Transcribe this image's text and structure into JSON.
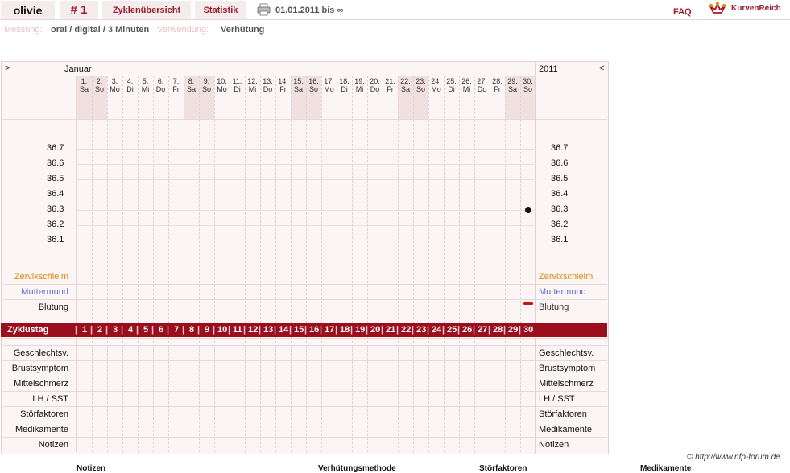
{
  "topbar": {
    "user": "olivie",
    "cycle_num": "# 1",
    "tab_cycles": "Zyklenübersicht",
    "tab_stats": "Statistik",
    "date_range": "01.01.2011 bis ∞",
    "faq": "FAQ",
    "brand": "KurvenReich"
  },
  "meta": {
    "measure_label": "Messung:",
    "measure_value": "oral / digital / 3 Minuten",
    "usage_label": "Verwendung:",
    "usage_value": "Verhütung"
  },
  "chart_header": {
    "prev": ">",
    "month": "Januar",
    "year": "2011",
    "next": "<"
  },
  "days": [
    {
      "d": "1.",
      "w": "Sa",
      "we": true
    },
    {
      "d": "2.",
      "w": "So",
      "we": true
    },
    {
      "d": "3.",
      "w": "Mo"
    },
    {
      "d": "4.",
      "w": "Di"
    },
    {
      "d": "5.",
      "w": "Mi"
    },
    {
      "d": "6.",
      "w": "Do"
    },
    {
      "d": "7.",
      "w": "Fr"
    },
    {
      "d": "8.",
      "w": "Sa",
      "we": true
    },
    {
      "d": "9.",
      "w": "So",
      "we": true
    },
    {
      "d": "10.",
      "w": "Mo"
    },
    {
      "d": "11.",
      "w": "Di"
    },
    {
      "d": "12.",
      "w": "Mi"
    },
    {
      "d": "13.",
      "w": "Do"
    },
    {
      "d": "14.",
      "w": "Fr"
    },
    {
      "d": "15.",
      "w": "Sa",
      "we": true
    },
    {
      "d": "16.",
      "w": "So",
      "we": true
    },
    {
      "d": "17.",
      "w": "Mo"
    },
    {
      "d": "18.",
      "w": "Di"
    },
    {
      "d": "19.",
      "w": "Mi"
    },
    {
      "d": "20.",
      "w": "Do"
    },
    {
      "d": "21.",
      "w": "Fr"
    },
    {
      "d": "22.",
      "w": "Sa",
      "we": true
    },
    {
      "d": "23.",
      "w": "So",
      "we": true
    },
    {
      "d": "24.",
      "w": "Mo"
    },
    {
      "d": "25.",
      "w": "Di"
    },
    {
      "d": "26.",
      "w": "Mi"
    },
    {
      "d": "27.",
      "w": "Do"
    },
    {
      "d": "28.",
      "w": "Fr"
    },
    {
      "d": "29.",
      "w": "Sa",
      "we": true
    },
    {
      "d": "30.",
      "w": "So",
      "we": true
    }
  ],
  "temps": [
    "36.7",
    "36.6",
    "36.5",
    "36.4",
    "36.3",
    "36.2",
    "36.1"
  ],
  "measurement": {
    "day": 30,
    "temp": 36.3
  },
  "bleeding": {
    "day": 30
  },
  "colors": {
    "brand": "#9c1a2c",
    "zervix": "#e8860a",
    "muttermund": "#5a6fd0",
    "bleed": "#cc1111"
  },
  "rows_mid": {
    "zervix": "Zervixschleim",
    "muttermund": "Muttermund",
    "blutung": "Blutung"
  },
  "zyklustag_label": "Zyklustag",
  "cycle_days": [
    "1",
    "2",
    "3",
    "4",
    "5",
    "6",
    "7",
    "8",
    "9",
    "10",
    "11",
    "12",
    "13",
    "14",
    "15",
    "16",
    "17",
    "18",
    "19",
    "20",
    "21",
    "22",
    "23",
    "24",
    "25",
    "26",
    "27",
    "28",
    "29",
    "30"
  ],
  "rows_bottom": [
    "Geschlechtsv.",
    "Brustsymptom",
    "Mittelschmerz",
    "LH / SST",
    "Störfaktoren",
    "Medikamente",
    "Notizen"
  ],
  "footer": {
    "credit": "© http://www.nfp-forum.de",
    "col1": "Notizen",
    "col2": "Verhütungsmethode",
    "col3": "Störfaktoren",
    "col4": "Medikamente"
  }
}
